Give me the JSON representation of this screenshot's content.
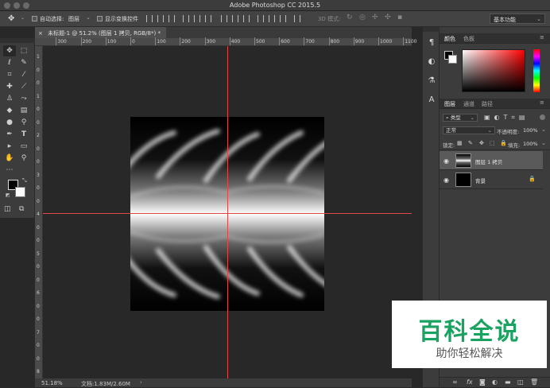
{
  "window": {
    "title": "Adobe Photoshop CC 2015.5"
  },
  "options": {
    "auto_select_label": "自动选择:",
    "auto_select_value": "图层",
    "show_transform_label": "显示变换控件",
    "mode3d_label": "3D 模式:",
    "workspace": "基本功能"
  },
  "document": {
    "tab_title": "未标题-1 @ 51.2% (图层 1 拷贝, RGB/8*) *",
    "close_glyph": "×"
  },
  "ruler": {
    "top_labels": [
      "300",
      "200",
      "100",
      "0",
      "100",
      "200",
      "300",
      "400",
      "500",
      "600",
      "700",
      "800",
      "900",
      "1000",
      "1100"
    ],
    "left_labels": [
      "1",
      "0",
      "0",
      "1",
      "0",
      "0",
      "2",
      "0",
      "0",
      "3",
      "0",
      "0",
      "4",
      "0",
      "0",
      "5",
      "0",
      "0",
      "6",
      "0",
      "0",
      "7",
      "0",
      "0",
      "8"
    ]
  },
  "status": {
    "zoom": "51.18%",
    "doc_info": "文档:1.83M/2.60M"
  },
  "panels": {
    "color_tabs": [
      "颜色",
      "色板"
    ],
    "layers_tabs": [
      "图层",
      "通道",
      "路径"
    ],
    "kind_filter": "类型",
    "blend_mode": "正常",
    "opacity_label": "不透明度:",
    "opacity_value": "100%",
    "lock_label": "锁定:",
    "fill_label": "填充:",
    "fill_value": "100%",
    "layers": [
      {
        "name": "图层 1 拷贝"
      },
      {
        "name": "背景"
      }
    ]
  },
  "watermark": {
    "line1": "百科全说",
    "line2": "助你轻松解决"
  },
  "colors": {
    "guide": "#e0474c",
    "watermark_green": "#1aa261"
  }
}
